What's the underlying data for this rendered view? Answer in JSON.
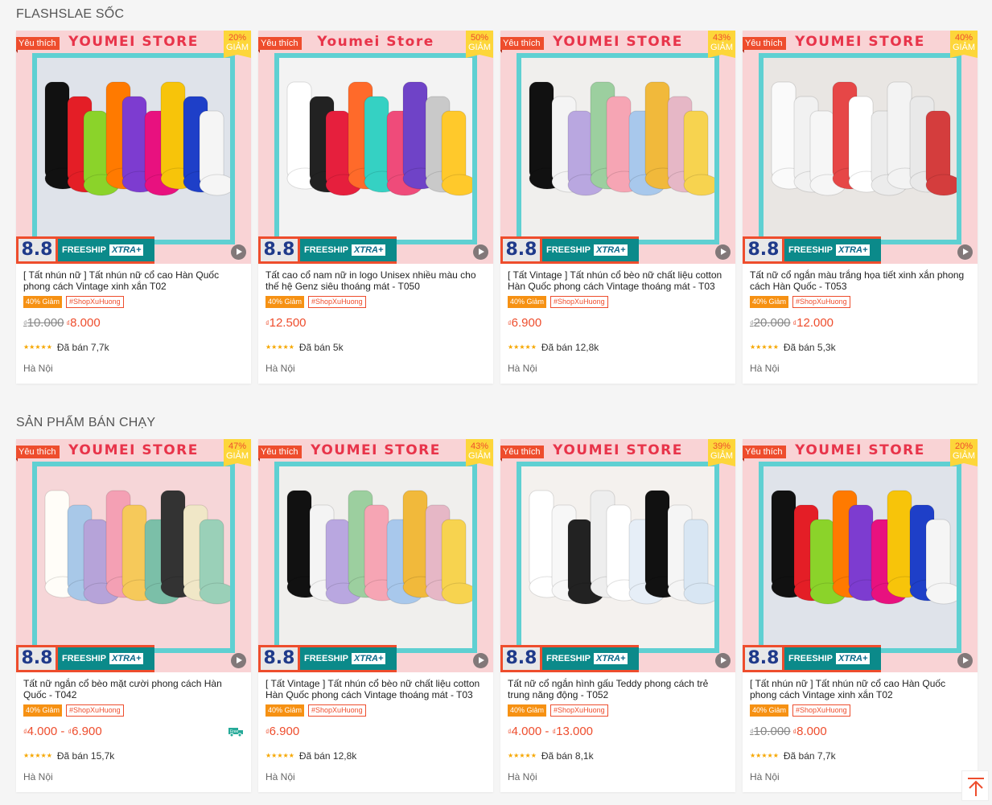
{
  "sections": [
    {
      "title": "FLASHSLAE SỐC",
      "products": [
        {
          "store": "YOUMEI STORE",
          "fav": "Yêu thích",
          "discount_pct": "20%",
          "discount_off": "GIẢM",
          "promo": "8.8",
          "freeship": "FREESHIP",
          "xtra": "XTRA+",
          "name": "[ Tất nhún nữ ] Tất nhún nữ cổ cao Hàn Quốc phong cách Vintage xinh xắn T02",
          "tag_discount": "40% Giảm",
          "tag_trend": "#ShopXuHuong",
          "old_price": "10.000",
          "price": "8.000",
          "price_max": "",
          "sold": "Đã bán 7,7k",
          "location": "Hà Nội",
          "currency": "₫",
          "free_ship_icon": false,
          "photo": "colorful"
        },
        {
          "store": "Youmei Store",
          "fav": "Yêu thích",
          "discount_pct": "50%",
          "discount_off": "GIẢM",
          "promo": "8.8",
          "freeship": "FREESHIP",
          "xtra": "XTRA+",
          "name": "Tất cao cổ nam nữ in logo Unisex nhiều màu cho thế hệ Genz siêu thoáng mát - T050",
          "tag_discount": "40% Giảm",
          "tag_trend": "#ShopXuHuong",
          "old_price": "",
          "price": "12.500",
          "price_max": "",
          "sold": "Đã bán 5k",
          "location": "Hà Nội",
          "currency": "₫",
          "free_ship_icon": false,
          "photo": "nike"
        },
        {
          "store": "YOUMEI STORE",
          "fav": "Yêu thích",
          "discount_pct": "43%",
          "discount_off": "GIẢM",
          "promo": "8.8",
          "freeship": "FREESHIP",
          "xtra": "XTRA+",
          "name": "[ Tất Vintage ] Tất nhún cổ bèo nữ chất liệu cotton Hàn Quốc phong cách Vintage thoáng mát - T03",
          "tag_discount": "40% Giảm",
          "tag_trend": "#ShopXuHuong",
          "old_price": "",
          "price": "6.900",
          "price_max": "",
          "sold": "Đã bán 12,8k",
          "location": "Hà Nội",
          "currency": "₫",
          "free_ship_icon": false,
          "photo": "pastel"
        },
        {
          "store": "YOUMEI STORE",
          "fav": "Yêu thích",
          "discount_pct": "40%",
          "discount_off": "GIẢM",
          "promo": "8.8",
          "freeship": "FREESHIP",
          "xtra": "XTRA+",
          "name": "Tất nữ cổ ngắn màu trắng họa tiết xinh xắn phong cách Hàn Quốc - T053",
          "tag_discount": "40% Giảm",
          "tag_trend": "#ShopXuHuong",
          "old_price": "20.000",
          "price": "12.000",
          "price_max": "",
          "sold": "Đã bán 5,3k",
          "location": "Hà Nội",
          "currency": "₫",
          "free_ship_icon": false,
          "photo": "white"
        }
      ]
    },
    {
      "title": "SẢN PHẨM BÁN CHẠY",
      "products": [
        {
          "store": "YOUMEI STORE",
          "fav": "Yêu thích",
          "discount_pct": "47%",
          "discount_off": "GIẢM",
          "promo": "8.8",
          "freeship": "FREESHIP",
          "xtra": "XTRA+",
          "name": "Tất nữ ngắn cổ bèo mặt cười phong cách Hàn Quốc - T042",
          "tag_discount": "40% Giảm",
          "tag_trend": "#ShopXuHuong",
          "old_price": "",
          "price": "4.000",
          "price_max": "6.900",
          "sold": "Đã bán 15,7k",
          "location": "Hà Nội",
          "currency": "₫",
          "free_ship_icon": true,
          "photo": "ankle"
        },
        {
          "store": "YOUMEI STORE",
          "fav": "Yêu thích",
          "discount_pct": "43%",
          "discount_off": "GIẢM",
          "promo": "8.8",
          "freeship": "FREESHIP",
          "xtra": "XTRA+",
          "name": "[ Tất Vintage ] Tất nhún cổ bèo nữ chất liệu cotton Hàn Quốc phong cách Vintage thoáng mát - T03",
          "tag_discount": "40% Giảm",
          "tag_trend": "#ShopXuHuong",
          "old_price": "",
          "price": "6.900",
          "price_max": "",
          "sold": "Đã bán 12,8k",
          "location": "Hà Nội",
          "currency": "₫",
          "free_ship_icon": false,
          "photo": "pastel"
        },
        {
          "store": "YOUMEI STORE",
          "fav": "Yêu thích",
          "discount_pct": "39%",
          "discount_off": "GIẢM",
          "promo": "8.8",
          "freeship": "FREESHIP",
          "xtra": "XTRA+",
          "name": "Tất nữ cổ ngắn hình gấu Teddy phong cách trẻ trung năng động - T052",
          "tag_discount": "40% Giảm",
          "tag_trend": "#ShopXuHuong",
          "old_price": "",
          "price": "4.000",
          "price_max": "13.000",
          "sold": "Đã bán 8,1k",
          "location": "Hà Nội",
          "currency": "₫",
          "free_ship_icon": false,
          "photo": "teddy"
        },
        {
          "store": "YOUMEI STORE",
          "fav": "Yêu thích",
          "discount_pct": "20%",
          "discount_off": "GIẢM",
          "promo": "8.8",
          "freeship": "FREESHIP",
          "xtra": "XTRA+",
          "name": "[ Tất nhún nữ ] Tất nhún nữ cổ cao Hàn Quốc phong cách Vintage xinh xắn T02",
          "tag_discount": "40% Giảm",
          "tag_trend": "#ShopXuHuong",
          "old_price": "10.000",
          "price": "8.000",
          "price_max": "",
          "sold": "Đã bán 7,7k",
          "location": "Hà Nội",
          "currency": "₫",
          "free_ship_icon": false,
          "photo": "colorful"
        }
      ]
    }
  ],
  "rating_stars": 5,
  "back_to_top_icon": "arrow-up-icon",
  "colors": {
    "accent": "#ee4d2d",
    "frame": "#5fd0d2",
    "banner_bg": "#f9d3d5",
    "discount_badge": "#fdd63a",
    "teal": "#0b8a8a"
  }
}
